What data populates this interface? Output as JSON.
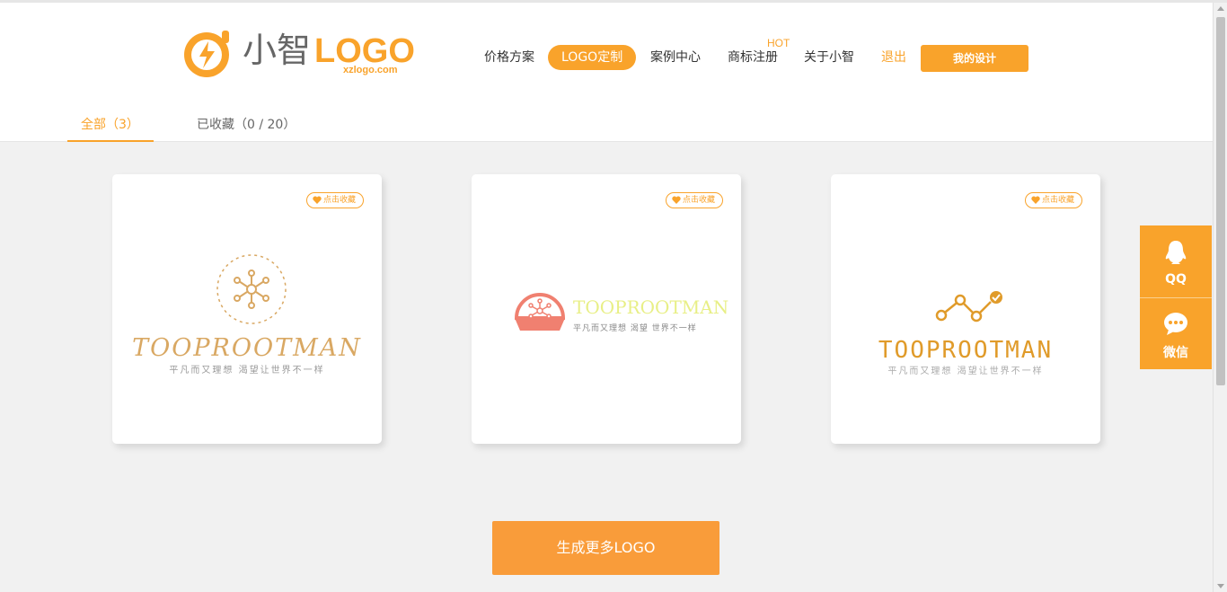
{
  "brand": {
    "name_cn": "小智",
    "name_en": "LOGO",
    "domain": "xzlogo.com",
    "color": "#f9a32b"
  },
  "nav": {
    "items": [
      {
        "label": "价格方案"
      },
      {
        "label": "LOGO定制"
      },
      {
        "label": "案例中心"
      },
      {
        "label": "商标注册"
      },
      {
        "label": "关于小智"
      },
      {
        "label": "退出"
      }
    ],
    "hot_badge": "HOT",
    "my_design": "我的设计"
  },
  "tabs": {
    "all": "全部（3）",
    "collected": "已收藏（0 / 20）"
  },
  "cards": [
    {
      "fav_label": "点击收藏",
      "logo_name": "TOOPROOTMAN",
      "slogan": "平凡而又理想 渴望让世界不一样",
      "logo_color": "#d9a863",
      "icon": "molecule-icon"
    },
    {
      "fav_label": "点击收藏",
      "logo_name": "TOOPROOTMAN",
      "slogan": "平凡而又理想 渴望 世界不一样",
      "logo_color": "#f08070",
      "icon": "dome-molecule-icon"
    },
    {
      "fav_label": "点击收藏",
      "logo_name": "TOOPROOTMAN",
      "slogan": "平凡而又理想 渴望让世界不一样",
      "logo_color": "#e09b2a",
      "icon": "chart-check-icon"
    }
  ],
  "side": {
    "qq_label": "QQ",
    "wechat_label": "微信"
  },
  "generate_label": "生成更多LOGO"
}
